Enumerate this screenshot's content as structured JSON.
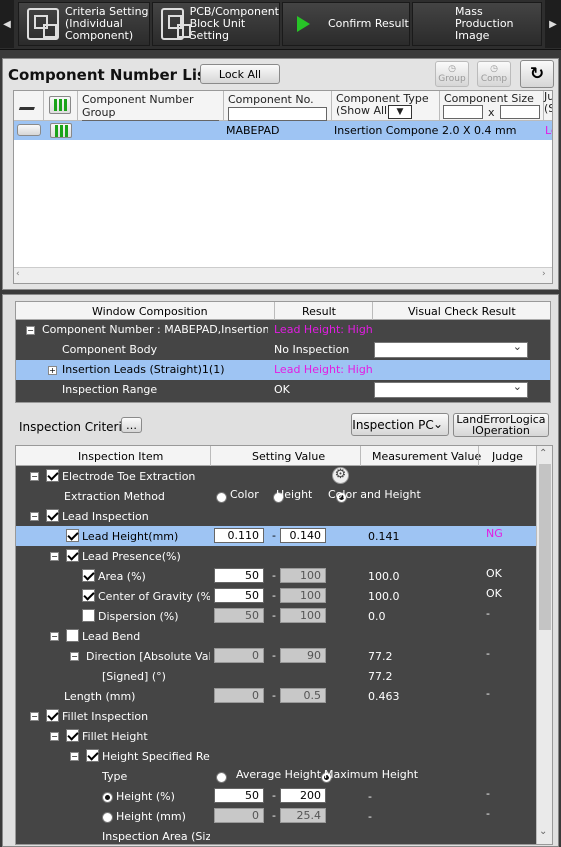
{
  "toolbar": {
    "buttons": [
      {
        "label": "Criteria Setting\n(Individual\nComponent)",
        "icon": "grid-settings-icon"
      },
      {
        "label": "PCB/Component\nBlock Unit\nSetting",
        "icon": "board-settings-icon"
      },
      {
        "label": "Confirm Result",
        "icon": "play-icon",
        "accent": "#27c427"
      },
      {
        "label": "Mass Production\nImage"
      }
    ],
    "left_arrow": "◀",
    "right_arrow": "▶"
  },
  "component_list": {
    "title": "Component Number List",
    "lock_all": "Lock All",
    "group_btn": "Group",
    "comp_btn": "Comp",
    "headers": [
      "Component Number Group",
      "Component No.",
      "Component Type\n(Show All)",
      "Component Size",
      "Ju\n(S"
    ],
    "size_sep": "x",
    "row": {
      "comp_no": "MABEPAD",
      "comp_type": "Insertion Component",
      "comp_size": "2.0 X 0.4 mm",
      "judge": "Le"
    }
  },
  "window": {
    "headers": [
      "Window Composition",
      "Result",
      "Visual Check Result"
    ],
    "rows": [
      {
        "name": "Component Number : MABEPAD,Insertion Co",
        "result": "Lead Height: High",
        "expand": "−"
      },
      {
        "name": "Component Body",
        "result": "No Inspection"
      },
      {
        "name": "Insertion Leads (Straight)1(1)",
        "result": "Lead Height: High",
        "expand": "+"
      },
      {
        "name": "Inspection Range",
        "result": "OK"
      }
    ]
  },
  "criteria": {
    "label": "Inspection Criteria",
    "more": "…",
    "pc": "Inspection PC",
    "land": "LandErrorLogica\nlOperation",
    "headers": [
      "Inspection Item",
      "Setting Value",
      "Measurement Value",
      "Judge"
    ],
    "rows": [
      {
        "label": "Electrode Toe Extraction",
        "meas": "",
        "judge": ""
      },
      {
        "label": "Extraction Method",
        "meas": "",
        "judge": ""
      },
      {
        "label": "Lead Inspection",
        "meas": "",
        "judge": ""
      },
      {
        "label": "Lead Height(mm)",
        "v1": "0.110",
        "v2": "0.140",
        "meas": "0.141",
        "judge": "NG"
      },
      {
        "label": "Lead Presence(%)",
        "meas": "",
        "judge": ""
      },
      {
        "label": "Area (%)",
        "v1": "50",
        "v2": "100",
        "meas": "100.0",
        "judge": "OK"
      },
      {
        "label": "Center of Gravity (%)",
        "v1": "50",
        "v2": "100",
        "meas": "100.0",
        "judge": "OK"
      },
      {
        "label": "Dispersion (%)",
        "v1": "50",
        "v2": "100",
        "meas": "0.0",
        "judge": "-"
      },
      {
        "label": "Lead Bend",
        "meas": "",
        "judge": ""
      },
      {
        "label": "Direction [Absolute Value",
        "v1": "0",
        "v2": "90",
        "meas": "77.2",
        "judge": "-"
      },
      {
        "label": "[Signed] (°)",
        "meas": "77.2",
        "judge": ""
      },
      {
        "label": "Length (mm)",
        "v1": "0",
        "v2": "0.5",
        "meas": "0.463",
        "judge": "-"
      },
      {
        "label": "Fillet Inspection",
        "meas": "",
        "judge": ""
      },
      {
        "label": "Fillet Height",
        "meas": "",
        "judge": ""
      },
      {
        "label": "Height Specified Regi",
        "meas": "",
        "judge": ""
      },
      {
        "label": "Type",
        "meas": "",
        "judge": ""
      },
      {
        "label": "Height (%)",
        "v1": "50",
        "v2": "200",
        "meas": "-",
        "judge": "-"
      },
      {
        "label": "Height (mm)",
        "v1": "0",
        "v2": "25.4",
        "meas": "-",
        "judge": "-"
      },
      {
        "label": "Inspection Area (Size)",
        "meas": "",
        "judge": ""
      }
    ],
    "extraction_opts": [
      "Color",
      "Height",
      "Color and Height"
    ],
    "type_opts": [
      "Average Height",
      "Maximum Height"
    ],
    "dash": "-"
  }
}
